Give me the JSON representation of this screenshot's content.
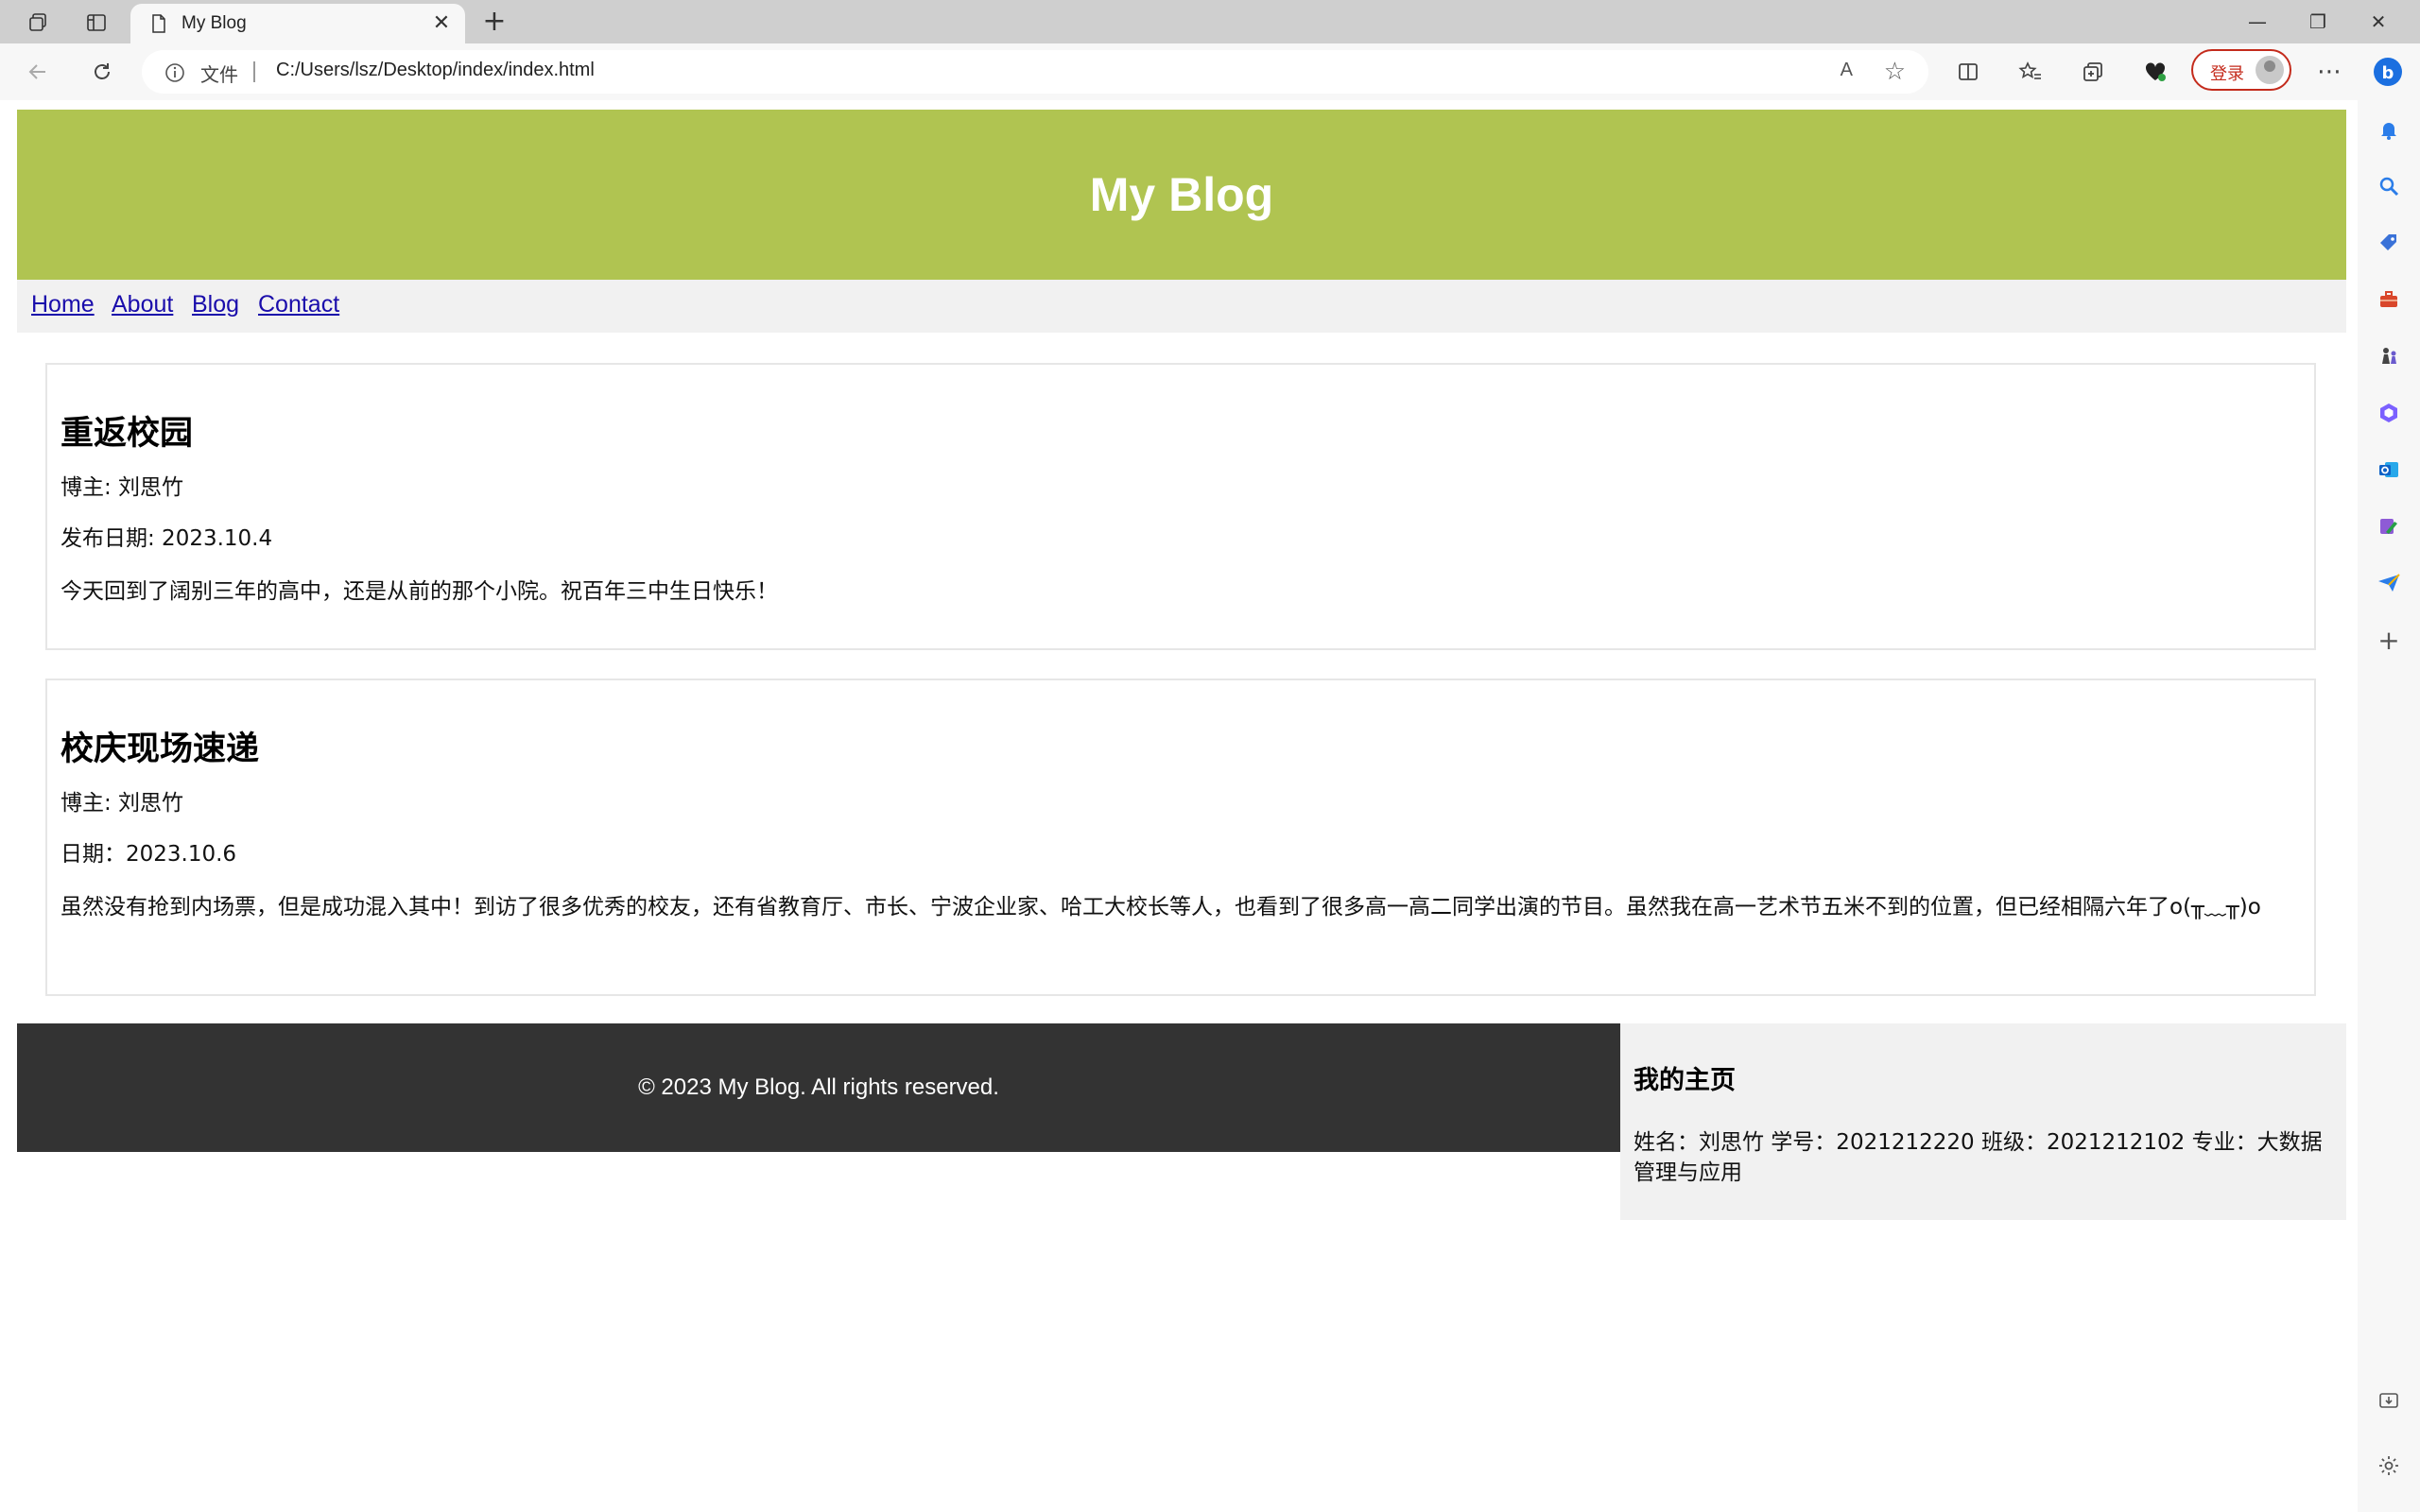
{
  "browser": {
    "tab_title": "My Blog",
    "address_prefix": "文件",
    "url": "C:/Users/lsz/Desktop/index/index.html",
    "read_aloud": "A",
    "login_label": "登录"
  },
  "page": {
    "header_title": "My Blog",
    "nav": [
      "Home",
      "About",
      "Blog",
      "Contact"
    ],
    "posts": [
      {
        "title": "重返校园",
        "author": "博主: 刘思竹",
        "date": "发布日期: 2023.10.4",
        "content": "今天回到了阔别三年的高中，还是从前的那个小院。祝百年三中生日快乐！"
      },
      {
        "title": "校庆现场速递",
        "author": "博主: 刘思竹",
        "date": "日期：2023.10.6",
        "content": "虽然没有抢到内场票，但是成功混入其中！到访了很多优秀的校友，还有省教育厅、市长、宁波企业家、哈工大校长等人，也看到了很多高一高二同学出演的节目。虽然我在高一艺术节五米不到的位置，但已经相隔六年了o(╥﹏╥)o"
      }
    ],
    "footer": "© 2023 My Blog. All rights reserved.",
    "aside": {
      "title": "我的主页",
      "info": "姓名：刘思竹 学号：2021212220 班级：2021212102 专业：大数据管理与应用"
    }
  },
  "colors": {
    "header_bg": "#b0c451",
    "footer_bg": "#333333",
    "nav_bg": "#f1f1f1",
    "link": "#1a0dab"
  },
  "icons": {
    "tab_actions": "tab-actions-icon",
    "vertical_tabs": "vertical-tabs-icon",
    "page": "page-icon",
    "info": "info-icon"
  }
}
